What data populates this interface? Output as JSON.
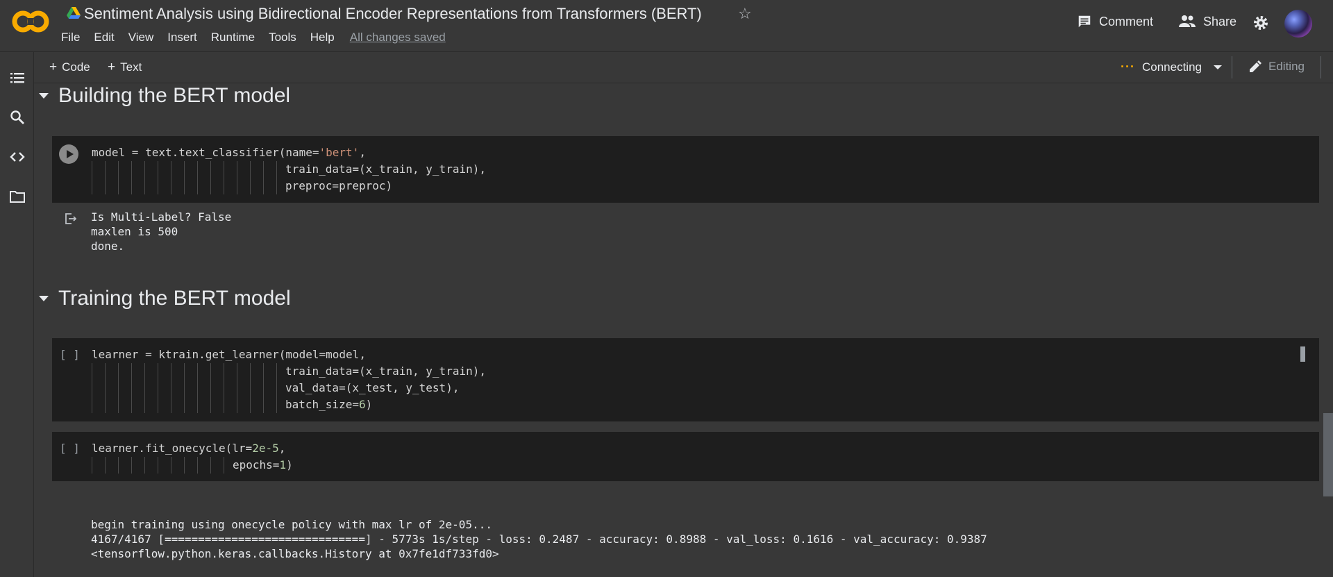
{
  "header": {
    "logo_text": "CO",
    "title": "Sentiment Analysis using Bidirectional Encoder Representations from Transformers (BERT)",
    "menu": [
      "File",
      "Edit",
      "View",
      "Insert",
      "Runtime",
      "Tools",
      "Help"
    ],
    "saved_status": "All changes saved",
    "comment_label": "Comment",
    "share_label": "Share"
  },
  "toolbar": {
    "add_code": "Code",
    "add_text": "Text",
    "connection_status": "Connecting",
    "mode": "Editing"
  },
  "sections": [
    {
      "title": "Building the BERT model"
    },
    {
      "title": "Training the BERT model"
    }
  ],
  "cells": [
    {
      "exec": "",
      "lines": [
        "model = text.text_classifier(name='bert',",
        "train_data=(x_train, y_train),",
        "preproc=preproc)"
      ],
      "output": [
        "Is Multi-Label? False",
        "maxlen is 500",
        "done."
      ]
    },
    {
      "exec": "[ ]",
      "lines": [
        "learner = ktrain.get_learner(model=model,",
        "train_data=(x_train, y_train),",
        "val_data=(x_test, y_test),",
        "batch_size=6)"
      ]
    },
    {
      "exec": "[ ]",
      "lines": [
        "learner.fit_onecycle(lr=2e-5,",
        "epochs=1)"
      ],
      "output": [
        "begin training using onecycle policy with max lr of 2e-05...",
        "4167/4167 [==============================] - 5773s 1s/step - loss: 0.2487 - accuracy: 0.8988 - val_loss: 0.1616 - val_accuracy: 0.9387",
        "<tensorflow.python.keras.callbacks.History at 0x7fe1df733fd0>"
      ]
    }
  ],
  "sidebar_icons": [
    "table-of-contents-icon",
    "search-icon",
    "code-snippets-icon",
    "files-icon"
  ],
  "colors": {
    "accent_orange": "#f9ab00",
    "background": "#383838",
    "cell_background": "#1e1e1e",
    "string": "#ce9178",
    "number": "#b5cea8"
  }
}
